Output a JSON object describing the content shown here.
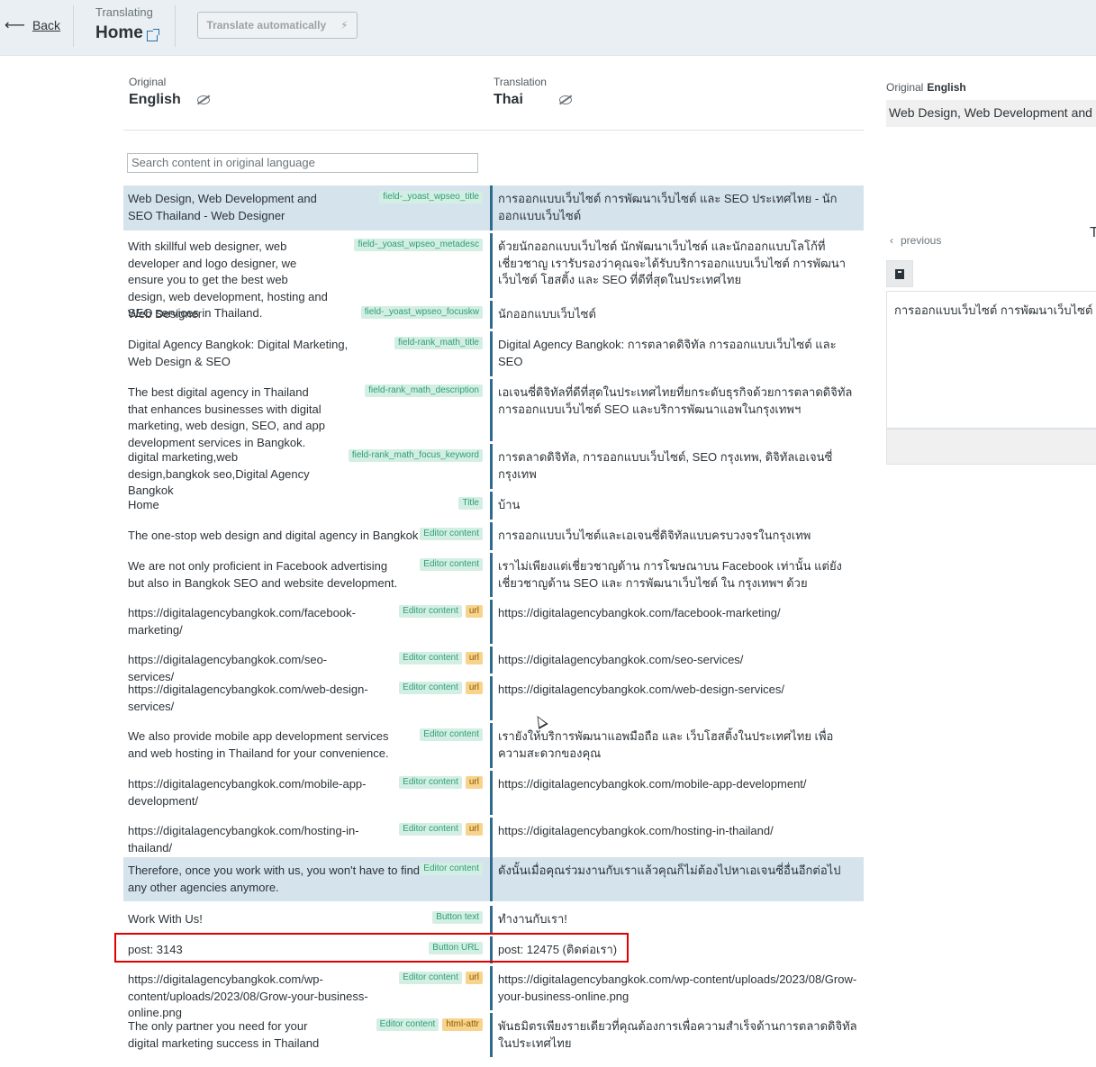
{
  "header": {
    "back_label": "Back",
    "translating_label": "Translating",
    "page_name": "Home",
    "auto_translate_label": "Translate automatically",
    "auto_translate_icon": "⚡"
  },
  "columns": {
    "original_label": "Original",
    "original_lang": "English",
    "translation_label": "Translation",
    "translation_lang": "Thai"
  },
  "search": {
    "placeholder": "Search content in original language"
  },
  "rows": [
    {
      "original": "Web Design, Web Development and SEO Thailand - Web Designer",
      "translation": "การออกแบบเว็บไซต์ การพัฒนาเว็บไซต์ และ SEO ประเทศไทย - นักออกแบบเว็บไซต์",
      "tags": [
        "field-_yoast_wpseo_title"
      ]
    },
    {
      "original": "With skillful web designer, web developer and logo designer, we ensure you to get the best web design, web development, hosting and SEO services in Thailand.",
      "translation": "ด้วยนักออกแบบเว็บไซต์ นักพัฒนาเว็บไซต์ และนักออกแบบโลโก้ที่เชี่ยวชาญ เรารับรองว่าคุณจะได้รับบริการออกแบบเว็บไซต์ การพัฒนาเว็บไซต์ โฮสติ้ง และ SEO ที่ดีที่สุดในประเทศไทย",
      "tags": [
        "field-_yoast_wpseo_metadesc"
      ]
    },
    {
      "original": "Web Designer",
      "translation": "นักออกแบบเว็บไซต์",
      "tags": [
        "field-_yoast_wpseo_focuskw"
      ]
    },
    {
      "original": "Digital Agency Bangkok: Digital Marketing, Web Design & SEO",
      "translation": "Digital Agency Bangkok: การตลาดดิจิทัล การออกแบบเว็บไซต์ และ SEO",
      "tags": [
        "field-rank_math_title"
      ]
    },
    {
      "original": "The best digital agency in Thailand that enhances businesses with digital marketing, web design, SEO, and app development services in Bangkok.",
      "translation": "เอเจนซี่ดิจิทัลที่ดีที่สุดในประเทศไทยที่ยกระดับธุรกิจด้วยการตลาดดิจิทัล การออกแบบเว็บไซต์ SEO และบริการพัฒนาแอพในกรุงเทพฯ",
      "tags": [
        "field-rank_math_description"
      ]
    },
    {
      "original": "digital marketing,web design,bangkok seo,Digital Agency Bangkok",
      "translation": "การตลาดดิจิทัล, การออกแบบเว็บไซต์, SEO กรุงเทพ, ดิจิทัลเอเจนซี่กรุงเทพ",
      "tags": [
        "field-rank_math_focus_keyword"
      ]
    },
    {
      "original": "Home",
      "translation": "บ้าน",
      "tags": [
        "Title"
      ]
    },
    {
      "original": "The one-stop web design and digital agency in Bangkok",
      "translation": "การออกแบบเว็บไซต์และเอเจนซี่ดิจิทัลแบบครบวงจรในกรุงเทพ",
      "tags": [
        "Editor content"
      ]
    },
    {
      "original": "We are not only proficient in Facebook advertising but also in Bangkok SEO and website development.",
      "translation": "เราไม่เพียงแต่เชี่ยวชาญด้าน การโฆษณาบน Facebook เท่านั้น แต่ยังเชี่ยวชาญด้าน SEO และ การพัฒนาเว็บไซต์ ใน กรุงเทพฯ ด้วย",
      "tags": [
        "Editor content"
      ]
    },
    {
      "original": "https://digitalagencybangkok.com/facebook-marketing/",
      "translation": "https://digitalagencybangkok.com/facebook-marketing/",
      "tags": [
        "Editor content",
        "url"
      ]
    },
    {
      "original": "https://digitalagencybangkok.com/seo-services/",
      "translation": "https://digitalagencybangkok.com/seo-services/",
      "tags": [
        "Editor content",
        "url"
      ]
    },
    {
      "original": "https://digitalagencybangkok.com/web-design-services/",
      "translation": "https://digitalagencybangkok.com/web-design-services/",
      "tags": [
        "Editor content",
        "url"
      ]
    },
    {
      "original": "We also provide mobile app development services and web hosting in Thailand for your convenience.",
      "translation": "เรายังให้บริการพัฒนาแอพมือถือ และ เว็บโฮสติ้งในประเทศไทย เพื่อความสะดวกของคุณ",
      "tags": [
        "Editor content"
      ]
    },
    {
      "original": "https://digitalagencybangkok.com/mobile-app-development/",
      "translation": "https://digitalagencybangkok.com/mobile-app-development/",
      "tags": [
        "Editor content",
        "url"
      ]
    },
    {
      "original": "https://digitalagencybangkok.com/hosting-in-thailand/",
      "translation": "https://digitalagencybangkok.com/hosting-in-thailand/",
      "tags": [
        "Editor content",
        "url"
      ]
    },
    {
      "original": "Therefore, once you work with us, you won't have to find any other agencies anymore.",
      "translation": "ดังนั้นเมื่อคุณร่วมงานกับเราแล้วคุณก็ไม่ต้องไปหาเอเจนซี่อื่นอีกต่อไป",
      "tags": [
        "Editor content"
      ]
    },
    {
      "original": "Work With Us!",
      "translation": "ทำงานกับเรา!",
      "tags": [
        "Button text"
      ]
    },
    {
      "original": "post: 3143",
      "translation": "post: 12475 (ติดต่อเรา)",
      "tags": [
        "Button URL"
      ]
    },
    {
      "original": "https://digitalagencybangkok.com/wp-content/uploads/2023/08/Grow-your-business-online.png",
      "translation": "https://digitalagencybangkok.com/wp-content/uploads/2023/08/Grow-your-business-online.png",
      "tags": [
        "Editor content",
        "url"
      ]
    },
    {
      "original": "The only partner you need for your digital marketing success in Thailand",
      "translation": "พันธมิตรเพียงรายเดียวที่คุณต้องการเพื่อความสำเร็จด้านการตลาดดิจิทัลในประเทศไทย",
      "tags": [
        "Editor content",
        "html-attr"
      ]
    }
  ],
  "right_panel": {
    "original_label": "Original",
    "original_lang": "English",
    "original_text": "Web Design, Web Development and SEO Thailand - Web Designer",
    "previous_label": "previous",
    "cut_letter": "T",
    "translation_text": "การออกแบบเว็บไซต์ การพัฒนาเว็บไซต์ และ SEO ประเทศไทย - นักออกแบบเว็บไซต์"
  },
  "colors": {
    "accent": "#2f6b8a",
    "highlight": "#d5e3ed",
    "tag_green": "#d3efe3",
    "tag_url": "#f8d38c",
    "redbox": "#e00000"
  }
}
